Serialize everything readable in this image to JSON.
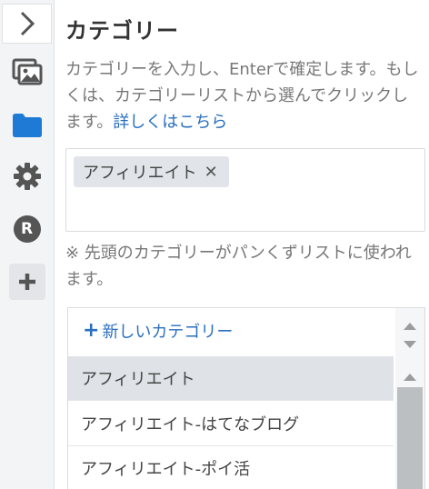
{
  "panel": {
    "title": "カテゴリー",
    "description": "カテゴリーを入力し、Enterで確定します。もしくは、カテゴリーリストから選んでクリックします。",
    "details_link": "詳しくはこちら",
    "note": "※ 先頭のカテゴリーがパンくずリストに使われます。"
  },
  "tags": [
    {
      "label": "アフィリエイト",
      "remove": "✕"
    }
  ],
  "category_list": {
    "new_label": "新しいカテゴリー",
    "items": [
      "アフィリエイト",
      "アフィリエイト-はてなブログ",
      "アフィリエイト-ポイ活"
    ],
    "selected_index": 0
  },
  "sidebar": {
    "icons": [
      "chevron-right-icon",
      "images-icon",
      "folder-icon",
      "gear-icon",
      "r-circle-icon",
      "plus-icon"
    ],
    "r_badge": "R"
  },
  "colors": {
    "accent": "#2a6fc0",
    "folder": "#1f7ad6",
    "icon_gray": "#555555"
  }
}
